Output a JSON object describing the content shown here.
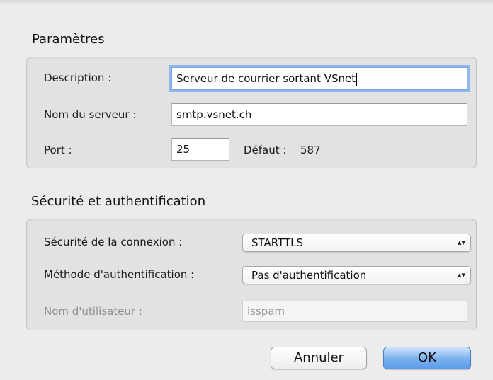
{
  "parametres": {
    "title": "Paramètres",
    "description_label": "Description :",
    "description_value": "Serveur de courrier sortant VSnet",
    "server_label": "Nom du serveur :",
    "server_value": "smtp.vsnet.ch",
    "port_label": "Port :",
    "port_value": "25",
    "default_label": "Défaut :",
    "default_value": "587"
  },
  "securite": {
    "title": "Sécurité et authentification",
    "connection_label": "Sécurité de la connexion :",
    "connection_value": "STARTTLS",
    "auth_label": "Méthode d'authentification :",
    "auth_value": "Pas d'authentification",
    "username_label": "Nom d'utilisateur :",
    "username_value": "isspam"
  },
  "buttons": {
    "cancel_label": "Annuler",
    "ok_label": "OK"
  },
  "colors": {
    "window_bg": "#ececec",
    "group_bg": "#e2e2e2",
    "focus_ring": "#8fb7ee",
    "default_button": "#79b0f0"
  },
  "icons": {
    "popup_arrows": "up-down-chevron-icon"
  }
}
